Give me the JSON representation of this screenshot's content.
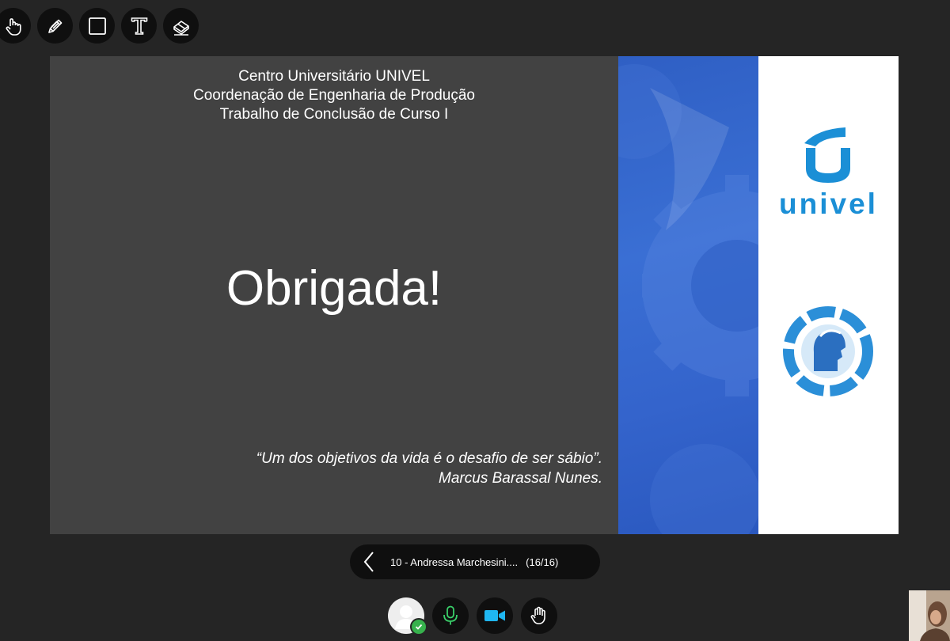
{
  "toolbar": {
    "tools": [
      {
        "name": "hand-icon"
      },
      {
        "name": "pencil-icon"
      },
      {
        "name": "square-icon"
      },
      {
        "name": "text-icon"
      },
      {
        "name": "eraser-icon"
      }
    ]
  },
  "slide": {
    "header_lines": [
      "Centro Universitário UNIVEL",
      "Coordenação de Engenharia de Produção",
      "Trabalho de Conclusão de Curso I"
    ],
    "headline": "Obrigada!",
    "quote": "“Um dos objetivos da vida é o desafio de ser sábio”.",
    "quote_author": "Marcus Barassal Nunes.",
    "logo_text": "univel"
  },
  "navigation": {
    "presentation_title": "10 - Andressa Marchesini....",
    "page_indicator": "(16/16)"
  },
  "colors": {
    "background": "#252525",
    "slide_dark": "#424242",
    "slide_blue": "#3464cc",
    "logo_blue": "#1b8fd6",
    "mic_green": "#3ad06a",
    "camera_blue": "#1fb6f0",
    "status_green": "#37b24d"
  }
}
